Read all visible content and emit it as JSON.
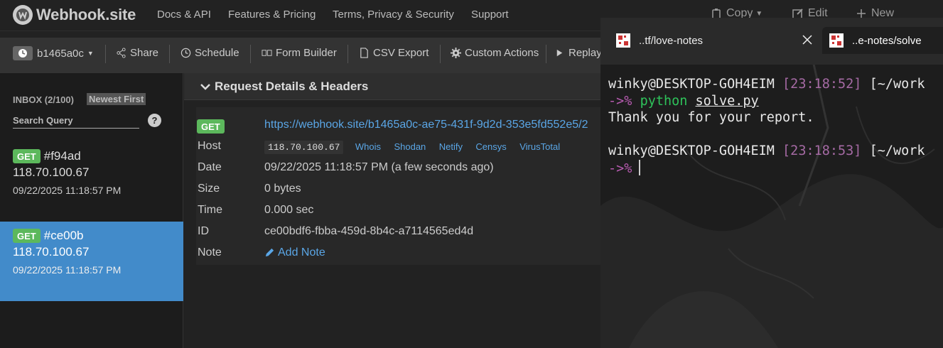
{
  "navbar": {
    "brand": "Webhook.site",
    "links": [
      "Docs & API",
      "Features & Pricing",
      "Terms, Privacy & Security",
      "Support"
    ],
    "copy_label": "Copy",
    "edit_label": "Edit",
    "new_label": "New"
  },
  "toolbar": {
    "token": "b1465a0c",
    "share": "Share",
    "schedule": "Schedule",
    "form_builder": "Form Builder",
    "csv_export": "CSV Export",
    "custom_actions": "Custom Actions",
    "replay": "Replay"
  },
  "sidebar": {
    "inbox_label": "INBOX (2/100)",
    "sort_label": "Newest First",
    "search_placeholder": "Search Query",
    "help_glyph": "?",
    "requests": [
      {
        "method": "GET",
        "hash": "#f94ad",
        "ip": "118.70.100.67",
        "time": "09/22/2025 11:18:57 PM",
        "active": false
      },
      {
        "method": "GET",
        "hash": "#ce00b",
        "ip": "118.70.100.67",
        "time": "09/22/2025 11:18:57 PM",
        "active": true
      }
    ]
  },
  "details": {
    "title": "Request Details & Headers",
    "method": "GET",
    "url": "https://webhook.site/b1465a0c-ae75-431f-9d2d-353e5fd552e5/2",
    "rows": {
      "host_label": "Host",
      "host_value": "118.70.100.67",
      "host_links": [
        "Whois",
        "Shodan",
        "Netify",
        "Censys",
        "VirusTotal"
      ],
      "date_label": "Date",
      "date_value": "09/22/2025 11:18:57 PM (a few seconds ago)",
      "size_label": "Size",
      "size_value": "0 bytes",
      "time_label": "Time",
      "time_value": "0.000 sec",
      "id_label": "ID",
      "id_value": "ce00bdf6-fbba-459d-8b4c-a7114565ed4d",
      "note_label": "Note",
      "note_value": "Add Note"
    }
  },
  "terminal": {
    "tabs": [
      "..tf/love-notes",
      "..e-notes/solve"
    ],
    "lines": [
      {
        "user": "winky@DESKTOP-GOH4EIM",
        "time": "[23:18:52]",
        "path": "[~/work"
      },
      {
        "prompt": "->%",
        "cmd": "python",
        "file": "solve.py"
      },
      {
        "output": "Thank you for your report."
      },
      {
        "user": "winky@DESKTOP-GOH4EIM",
        "time": "[23:18:53]",
        "path": "[~/work"
      },
      {
        "prompt": "->%"
      }
    ]
  },
  "colors": {
    "accent_blue": "#428bca",
    "get_green": "#5cb85c",
    "link_blue": "#5aa6e6",
    "prompt_magenta": "#b75bb0",
    "cmd_green": "#2ec25a"
  }
}
